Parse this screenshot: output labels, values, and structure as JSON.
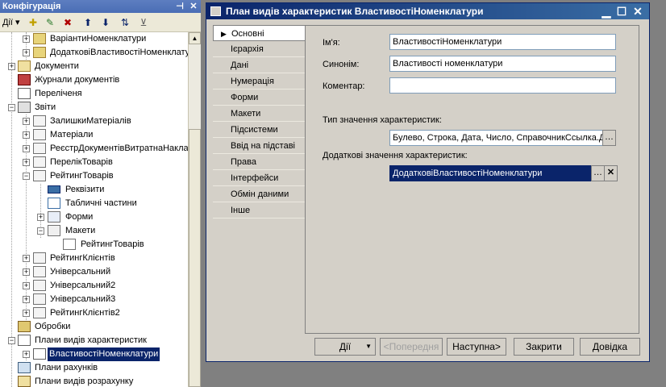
{
  "config_panel": {
    "title": "Конфігурація",
    "pin_icon": "pin-icon",
    "close_icon": "close-icon",
    "actions_label": "Дії ▾",
    "tree": [
      {
        "label": "ВаріантиНоменклатури",
        "icon": "folder-icon"
      },
      {
        "label": "ДодатковіВластивостіНоменклатури",
        "icon": "folder-icon"
      },
      {
        "label": "Документи",
        "icon": "documents-icon"
      },
      {
        "label": "Журнали документів",
        "icon": "journal-icon"
      },
      {
        "label": "Переліченя",
        "icon": "enum-icon"
      },
      {
        "label": "Звіти",
        "icon": "reports-icon"
      },
      {
        "label": "ЗалишкиМатеріалів",
        "icon": "report-icon"
      },
      {
        "label": "Матеріали",
        "icon": "report-icon"
      },
      {
        "label": "РеєстрДокументівВитратнаНакладна",
        "icon": "report-icon"
      },
      {
        "label": "ПерелікТоварів",
        "icon": "report-icon"
      },
      {
        "label": "РейтингТоварів",
        "icon": "report-icon"
      },
      {
        "label": "Реквізити",
        "icon": "attributes-icon"
      },
      {
        "label": "Табличні частини",
        "icon": "table-icon"
      },
      {
        "label": "Форми",
        "icon": "forms-icon"
      },
      {
        "label": "Макети",
        "icon": "templates-icon"
      },
      {
        "label": "РейтингТоварів",
        "icon": "template-icon"
      },
      {
        "label": "РейтингКлієнтів",
        "icon": "report-icon"
      },
      {
        "label": "Універсальний",
        "icon": "report-icon"
      },
      {
        "label": "Універсальний2",
        "icon": "report-icon"
      },
      {
        "label": "Універсальний3",
        "icon": "report-icon"
      },
      {
        "label": "РейтингКлієнтів2",
        "icon": "report-icon"
      },
      {
        "label": "Обробки",
        "icon": "processing-icon"
      },
      {
        "label": "Плани видів характеристик",
        "icon": "chart-of-characteristics-icon"
      },
      {
        "label": "ВластивостіНоменклатури",
        "icon": "chart-item-icon"
      },
      {
        "label": "Плани рахунків",
        "icon": "chart-of-accounts-icon"
      },
      {
        "label": "Плани видів розрахунку",
        "icon": "calculation-icon"
      }
    ]
  },
  "dialog": {
    "title": "План видів характеристик ВластивостіНоменклатури",
    "tabs": [
      "Основні",
      "Ієрархія",
      "Дані",
      "Нумерація",
      "Форми",
      "Макети",
      "Підсистеми",
      "Ввід на підставі",
      "Права",
      "Інтерфейси",
      "Обмін даними",
      "Інше"
    ],
    "active_tab": "Основні",
    "name_label": "Ім'я:",
    "name_value": "ВластивостіНоменклатури",
    "synonym_label": "Синонім:",
    "synonym_value": "Властивості номенклатури",
    "comment_label": "Коментар:",
    "comment_value": "",
    "type_label": "Тип значення характеристик:",
    "type_value": "Булево, Строка, Дата, Число, СправочникСсылка.Д",
    "extra_label": "Додаткові значення характеристик:",
    "extra_value": "ДодатковіВластивостіНоменклатури",
    "buttons": {
      "actions": "Дії",
      "prev": "<Попередня",
      "next": "Наступна>",
      "close": "Закрити",
      "help": "Довідка"
    }
  }
}
